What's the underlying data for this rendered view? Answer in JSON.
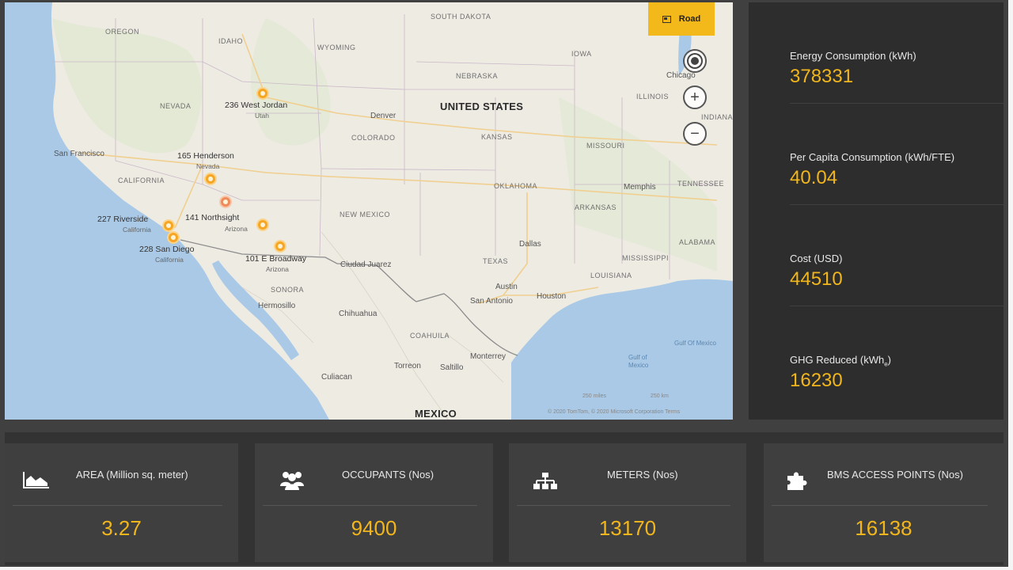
{
  "map": {
    "road_label": "Road",
    "country_labels": {
      "us": "UNITED STATES",
      "mexico": "MEXICO"
    },
    "state_labels": [
      "OREGON",
      "IDAHO",
      "WYOMING",
      "SOUTH DAKOTA",
      "IOWA",
      "NEBRASKA",
      "NEVADA",
      "CALIFORNIA",
      "COLORADO",
      "KANSAS",
      "MISSOURI",
      "ILLINOIS",
      "INDIANA",
      "OKLAHOMA",
      "ARKANSAS",
      "TENNESSEE",
      "NEW MEXICO",
      "TEXAS",
      "MISSISSIPPI",
      "ALABAMA",
      "LOUISIANA",
      "SONORA",
      "COAHUILA",
      "Chihuahua"
    ],
    "city_labels": [
      "San Francisco",
      "Denver",
      "Dallas",
      "Austin",
      "San Antonio",
      "Houston",
      "Memphis",
      "Chicago",
      "Monterrey",
      "Torreon",
      "Saltillo",
      "Hermosillo",
      "Culiacan",
      "Ciudad Juarez"
    ],
    "sea_label": "Gulf of Mexico",
    "gulf_label": "Gulf Of Mexico",
    "markers": [
      {
        "label": "236 West Jordan",
        "sub": "Utah"
      },
      {
        "label": "165 Henderson",
        "sub": "Nevada"
      },
      {
        "label": "141 Northsight",
        "sub": "Arizona"
      },
      {
        "label": "227 Riverside",
        "sub": "California"
      },
      {
        "label": "228 San Diego",
        "sub": "California"
      },
      {
        "label": "101 E Broadway",
        "sub": "Arizona"
      }
    ],
    "scale": {
      "miles": "250 miles",
      "km": "250 km"
    },
    "copyright": "© 2020 TomTom, © 2020 Microsoft Corporation  Terms"
  },
  "kpis": [
    {
      "title": "Energy Consumption (kWh)",
      "value": "378331"
    },
    {
      "title": "Per Capita Consumption (kWh/FTE)",
      "value": "40.04"
    },
    {
      "title": "Cost (USD)",
      "value": "44510"
    },
    {
      "title": "GHG Reduced (kWh",
      "title_sub": "e",
      "title_end": ")",
      "value": "16230"
    }
  ],
  "cards": [
    {
      "title": "AREA (Million sq. meter)",
      "value": "3.27",
      "icon": "area-chart-icon"
    },
    {
      "title": "OCCUPANTS (Nos)",
      "value": "9400",
      "icon": "people-icon"
    },
    {
      "title": "METERS (Nos)",
      "value": "13170",
      "icon": "hierarchy-icon"
    },
    {
      "title": "BMS ACCESS POINTS (Nos)",
      "value": "16138",
      "icon": "puzzle-icon"
    }
  ],
  "colors": {
    "accent": "#f2b61d",
    "road_button": "#f3b81a",
    "panel": "#2d2d2d",
    "card": "#3f3f3f"
  }
}
